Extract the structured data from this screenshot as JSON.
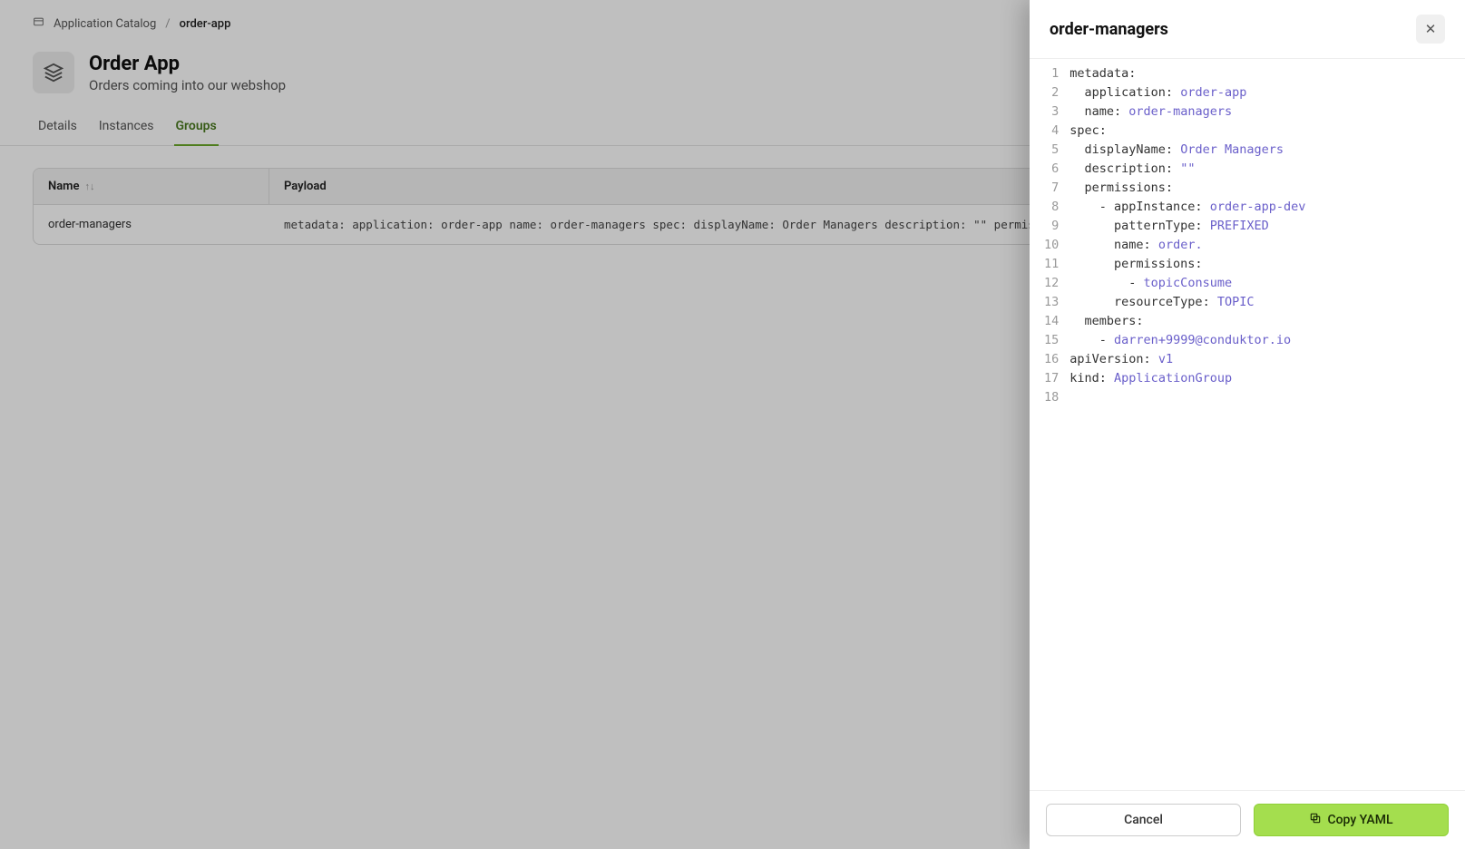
{
  "breadcrumb": {
    "root": "Application Catalog",
    "current": "order-app"
  },
  "header": {
    "title": "Order App",
    "subtitle": "Orders coming into our webshop"
  },
  "tabs": {
    "details": "Details",
    "instances": "Instances",
    "groups": "Groups"
  },
  "table": {
    "headers": {
      "name": "Name",
      "payload": "Payload"
    },
    "rows": [
      {
        "name": "order-managers",
        "payload": "metadata: application: order-app name: order-managers spec: displayName: Order Managers description: \"\" permission"
      }
    ]
  },
  "panel": {
    "title": "order-managers",
    "footer": {
      "cancel": "Cancel",
      "copy": "Copy YAML"
    },
    "yaml": [
      {
        "num": 1,
        "indent": 0,
        "key": "metadata:",
        "val": null
      },
      {
        "num": 2,
        "indent": 1,
        "key": "application: ",
        "val": "order-app"
      },
      {
        "num": 3,
        "indent": 1,
        "key": "name: ",
        "val": "order-managers"
      },
      {
        "num": 4,
        "indent": 0,
        "key": "spec:",
        "val": null
      },
      {
        "num": 5,
        "indent": 1,
        "key": "displayName: ",
        "val": "Order Managers"
      },
      {
        "num": 6,
        "indent": 1,
        "key": "description: ",
        "val": "\"\""
      },
      {
        "num": 7,
        "indent": 1,
        "key": "permissions:",
        "val": null
      },
      {
        "num": 8,
        "indent": 2,
        "key": "- appInstance: ",
        "val": "order-app-dev"
      },
      {
        "num": 9,
        "indent": 3,
        "key": "patternType: ",
        "val": "PREFIXED"
      },
      {
        "num": 10,
        "indent": 3,
        "key": "name: ",
        "val": "order."
      },
      {
        "num": 11,
        "indent": 3,
        "key": "permissions:",
        "val": null
      },
      {
        "num": 12,
        "indent": 4,
        "key": "- ",
        "val": "topicConsume"
      },
      {
        "num": 13,
        "indent": 3,
        "key": "resourceType: ",
        "val": "TOPIC"
      },
      {
        "num": 14,
        "indent": 1,
        "key": "members:",
        "val": null
      },
      {
        "num": 15,
        "indent": 2,
        "key": "- ",
        "val": "darren+9999@conduktor.io"
      },
      {
        "num": 16,
        "indent": 0,
        "key": "apiVersion: ",
        "val": "v1"
      },
      {
        "num": 17,
        "indent": 0,
        "key": "kind: ",
        "val": "ApplicationGroup"
      },
      {
        "num": 18,
        "indent": 0,
        "key": "",
        "val": null
      }
    ]
  }
}
